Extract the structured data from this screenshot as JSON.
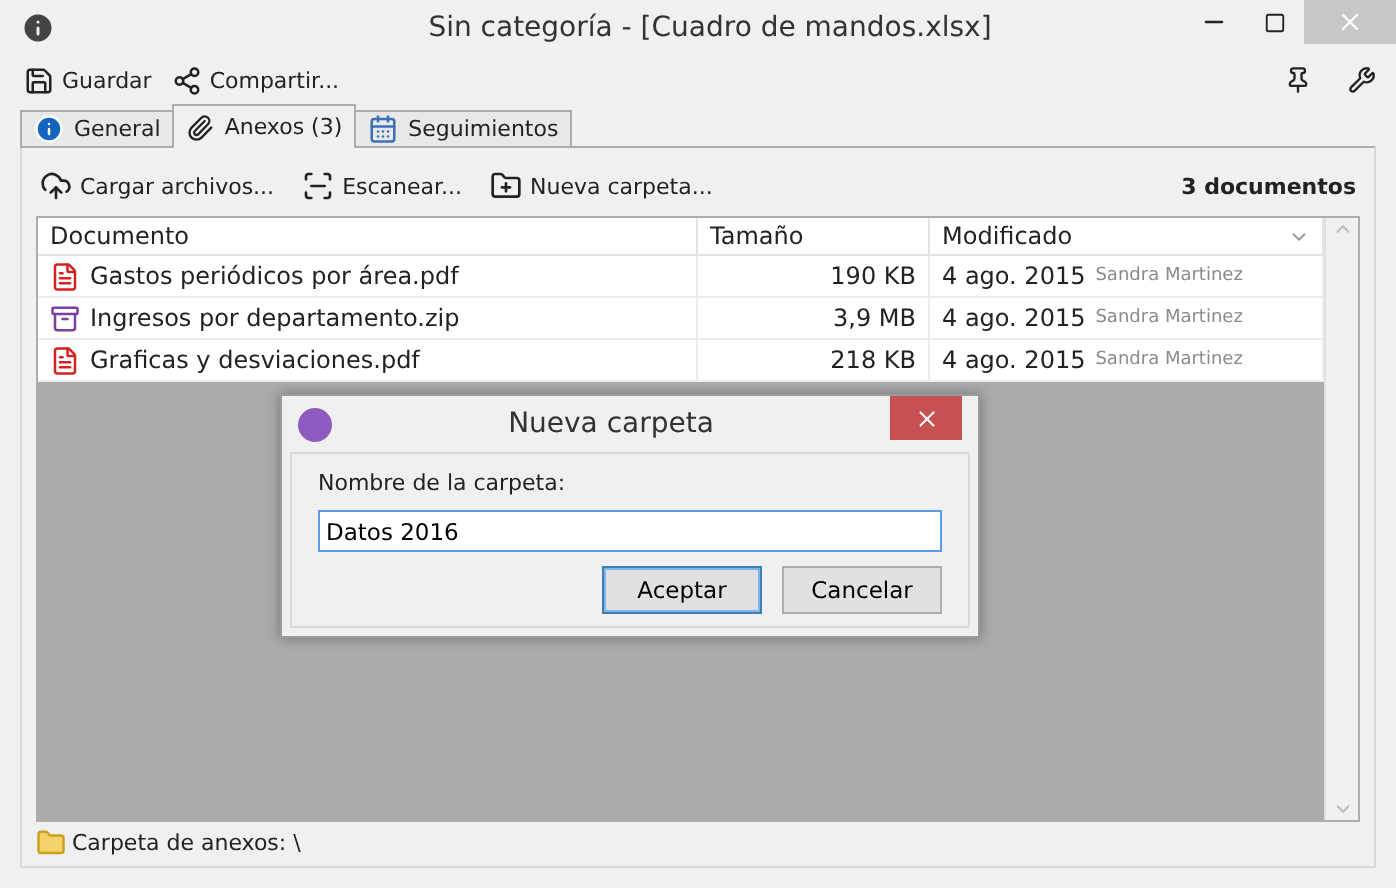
{
  "window": {
    "title": "Sin categoría - [Cuadro de mandos.xlsx]"
  },
  "toolbar": [
    {
      "kind": "save",
      "label": "Guardar"
    },
    {
      "kind": "share",
      "label": "Compartir..."
    }
  ],
  "tabs": [
    {
      "kind": "info",
      "label": "General",
      "selected": false
    },
    {
      "kind": "clip",
      "label": "Anexos (3)",
      "selected": true
    },
    {
      "kind": "calendar",
      "label": "Seguimientos",
      "selected": false
    }
  ],
  "actions": [
    {
      "kind": "upload",
      "label": "Cargar archivos..."
    },
    {
      "kind": "scan",
      "label": "Escanear..."
    },
    {
      "kind": "folder",
      "label": "Nueva carpeta..."
    }
  ],
  "document_count": "3 documentos",
  "table": {
    "columns": [
      "Documento",
      "Tamaño",
      "Modificado"
    ],
    "rows": [
      {
        "kind": "pdf",
        "name": "Gastos periódicos por área.pdf",
        "size": "190 KB",
        "date": "4 ago. 2015",
        "author": "Sandra Martinez"
      },
      {
        "kind": "zip",
        "name": "Ingresos por departamento.zip",
        "size": "3,9 MB",
        "date": "4 ago. 2015",
        "author": "Sandra Martinez"
      },
      {
        "kind": "pdf",
        "name": "Graficas y desviaciones.pdf",
        "size": "218 KB",
        "date": "4 ago. 2015",
        "author": "Sandra Martinez"
      }
    ]
  },
  "status_bar": "Carpeta de anexos: \\",
  "dialog": {
    "title": "Nueva carpeta",
    "label": "Nombre de la carpeta:",
    "value": "Datos 2016",
    "buttons": [
      {
        "label": "Aceptar",
        "default": true
      },
      {
        "label": "Cancelar",
        "default": false
      }
    ]
  }
}
